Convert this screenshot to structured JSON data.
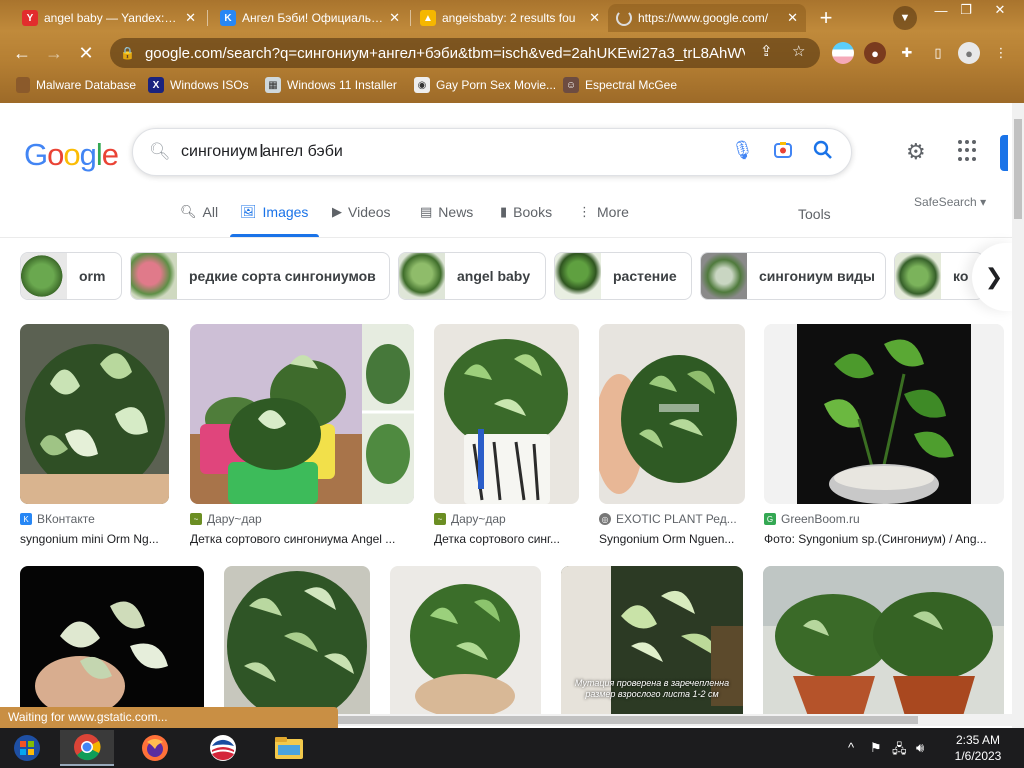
{
  "browser": {
    "tabs": [
      {
        "title": "angel baby — Yandex: 2 m",
        "favicon": "Y",
        "color": "#e22d2d"
      },
      {
        "title": "Ангел Бэби! Официальный",
        "favicon": "vk",
        "color": "#2787f5"
      },
      {
        "title": "angeisbaby: 2 results fou",
        "favicon": "img",
        "color": "#f5b700"
      },
      {
        "title": "https://www.google.com/",
        "favicon": "loading",
        "color": "#8a8a8a"
      }
    ],
    "url": "google.com/search?q=сингониум+ангел+бэби&tbm=isch&ved=2ahUKEwi27a3_trL8AhWVi3...",
    "bookmarks": [
      {
        "label": "Malware Database"
      },
      {
        "label": "Windows ISOs"
      },
      {
        "label": "Windows 11 Installer"
      },
      {
        "label": "Gay Porn Sex Movie..."
      },
      {
        "label": "Espectral McGee"
      }
    ],
    "status": "Waiting for www.gstatic.com..."
  },
  "google": {
    "query": "сингониум ангел бэби",
    "nav": {
      "all": "All",
      "images": "Images",
      "videos": "Videos",
      "news": "News",
      "books": "Books",
      "more": "More",
      "tools": "Tools",
      "safesearch": "SafeSearch"
    },
    "chips": [
      {
        "label": "orm"
      },
      {
        "label": "редкие сорта сингониумов"
      },
      {
        "label": "angel baby"
      },
      {
        "label": "растение"
      },
      {
        "label": "сингониум виды"
      },
      {
        "label": "ко"
      }
    ],
    "results": [
      {
        "source": "ВКонтакте",
        "title": "syngonium mini Orm Ng..."
      },
      {
        "source": "Дару~дар",
        "title": "Детка сортового сингониума Angel ..."
      },
      {
        "source": "Дару~дар",
        "title": "Детка сортового синг..."
      },
      {
        "source": "EXOTIC PLANT Ред...",
        "title": "Syngonium Orm Nguen..."
      },
      {
        "source": "GreenBoom.ru",
        "title": "Фото: Syngonium sp.(Сингониум) / Ang..."
      }
    ],
    "row2_caption": "Мутация проверена в заречепленна размер взрослого листа 1-2 см"
  },
  "taskbar": {
    "time": "2:35 AM",
    "date": "1/6/2023"
  }
}
